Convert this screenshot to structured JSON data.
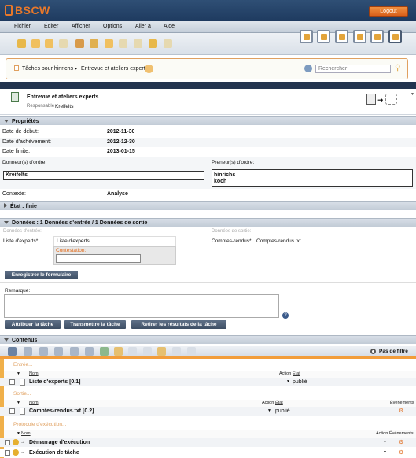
{
  "app": {
    "logo": "BSCW",
    "logout": "Logout"
  },
  "menu": [
    "Fichier",
    "Éditer",
    "Afficher",
    "Options",
    "Aller à",
    "Aide"
  ],
  "breadcrumb": {
    "root": "Tâches pour hinrichs",
    "sep": "▸",
    "current": "Entrevue et ateliers experts"
  },
  "search": {
    "placeholder": "Rechercher"
  },
  "task": {
    "title": "Entrevue et ateliers experts",
    "resp_label": "Responsable",
    "resp_value": "Kreifelts"
  },
  "props": {
    "title": "Propriétés",
    "rows": [
      {
        "label": "Date de début:",
        "value": "2012-11-30"
      },
      {
        "label": "Date d'achèvement:",
        "value": "2012-12-30"
      },
      {
        "label": "Date limite:",
        "value": "2013-01-15"
      }
    ],
    "donneur_label": "Donneur(s) d'ordre:",
    "donneur_value": "Kreifelts",
    "preneur_label": "Preneur(s) d'ordre:",
    "preneur_values": [
      "hinrichs",
      "koch"
    ],
    "contexte_label": "Contexte:",
    "contexte_value": "Analyse"
  },
  "state": {
    "title": "État : finie"
  },
  "donnees": {
    "title": "Données : 1 Données d'entrée / 1 Données de sortie",
    "entree_label": "Données d'entrée:",
    "sortie_label": "Données de sortie:",
    "liste_label": "Liste d'experts*",
    "liste_value": "Liste d'experts",
    "contest_label": "Contestation:",
    "comptes_label": "Comptes-rendus*",
    "comptes_value": "Comptes-rendus.txt",
    "save_btn": "Enregistrer le formulaire",
    "remarque_label": "Remarque:",
    "btn_attrib": "Attribuer la tâche",
    "btn_trans": "Transmettre la tâche",
    "btn_retirer": "Retirer les résultats de la tâche"
  },
  "contenus": {
    "title": "Contenus",
    "filter": "Pas de filtre",
    "entree": "Entrée...",
    "sortie": "Sortie...",
    "protocole": "Protocole d'exécution...",
    "col_nom": "Nom",
    "col_action": "Action",
    "col_etat": "État",
    "col_evenements": "Événements",
    "items": [
      {
        "name": "Liste d'experts [0.1]",
        "state": "publié"
      },
      {
        "name": "Comptes-rendus.txt [0.2]",
        "state": "publié"
      }
    ],
    "protocol_items": [
      "Démarrage d'exécution",
      "Exécution de tâche"
    ]
  },
  "colors": {
    "accent": "#f29d3b",
    "header": "#22344f",
    "button": "#4a5b72"
  }
}
